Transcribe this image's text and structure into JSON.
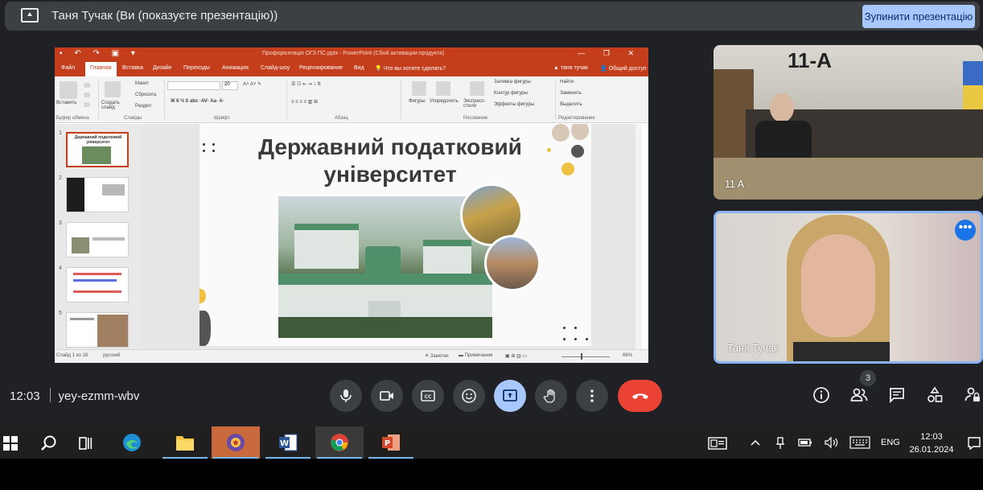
{
  "meet": {
    "presenting_title": "Таня Тучак (Ви (показуєте презентацію))",
    "stop_button": "Зупинити презентацію",
    "time": "12:03",
    "meeting_code": "yey-ezmm-wbv",
    "participants_count": "3"
  },
  "tiles": [
    {
      "name": "11 A",
      "sign": "11-А"
    },
    {
      "name": "Таня Тучак",
      "more": "•••"
    }
  ],
  "ppt": {
    "qat": "▪ ↶ ↷ ▣ ▾",
    "doc_title": "Профорієнтація ОГЗ ПС.pptx - PowerPoint (Сбой активации продукта)",
    "window_controls": "— ❐ ✕",
    "tabs": [
      "Файл",
      "Главная",
      "Вставка",
      "Дизайн",
      "Переходы",
      "Анимация",
      "Слайд-шоу",
      "Рецензирование",
      "Вид"
    ],
    "tell_me": "Что вы хотите сделать?",
    "user": "таня тучак",
    "share": "Общий доступ",
    "ribbon": {
      "paste": "Вставить",
      "new_slide": "Создать слайд",
      "layout": "Макет",
      "reset": "Сбросить",
      "section": "Раздел",
      "shapes": "Фигуры",
      "arrange": "Упорядочить",
      "quick_styles": "Экспресс-стили",
      "fill": "Заливка фигуры",
      "outline": "Контур фигуры",
      "effects": "Эффекты фигуры",
      "find": "Найти",
      "replace": "Заменить",
      "select": "Выделить",
      "font_size": "20",
      "groups": [
        "Буфер обмена",
        "Слайды",
        "Шрифт",
        "Абзац",
        "Рисование",
        "Редактирование"
      ]
    },
    "thumb_numbers": [
      "1",
      "2",
      "3",
      "4",
      "5"
    ],
    "thumb1_title": "Державний податковий університет",
    "slide_title": "Державний податковий університет",
    "status_left": "Слайд 1 из 18",
    "status_lang": "русский",
    "notes": "Заметки",
    "comments": "Примечания",
    "zoom": "66%"
  },
  "taskbar": {
    "clock_time": "12:03",
    "clock_date": "26.01.2024",
    "lang": "ENG"
  },
  "colors": {
    "meet_bg": "#202124",
    "accent_blue": "#a8c7fa",
    "end_call": "#ea4335",
    "ppt_orange": "#c43e1c"
  }
}
